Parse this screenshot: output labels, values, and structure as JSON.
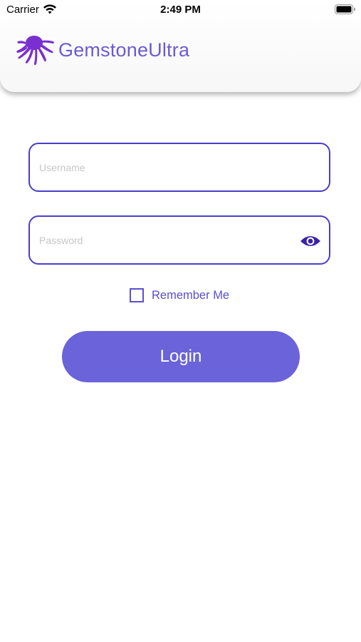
{
  "status_bar": {
    "carrier": "Carrier",
    "time": "2:49 PM",
    "wifi_icon": "wifi-icon",
    "battery_icon": "battery-icon"
  },
  "header": {
    "title": "GemstoneUltra",
    "logo_icon": "octopus-logo-icon"
  },
  "form": {
    "username": {
      "placeholder": "Username",
      "value": ""
    },
    "password": {
      "placeholder": "Password",
      "value": "",
      "toggle_icon": "eye-icon"
    },
    "remember_me": {
      "label": "Remember Me",
      "checked": false
    },
    "login_label": "Login"
  },
  "colors": {
    "brand": "#6a5bd4",
    "field_border": "#4a3ec9",
    "button": "#6a63d9",
    "eye_icon": "#3b22a8",
    "logo": "#7a2fd0"
  }
}
